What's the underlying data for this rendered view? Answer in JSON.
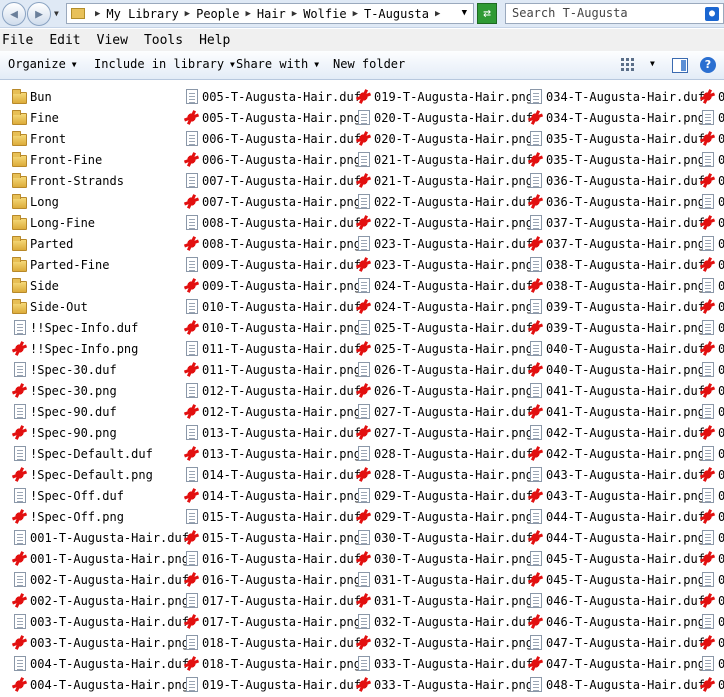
{
  "address": {
    "breadcrumbs": [
      "My Library",
      "People",
      "Hair",
      "Wolfie",
      "T-Augusta"
    ],
    "search_placeholder": "Search T-Augusta"
  },
  "menu": [
    "File",
    "Edit",
    "View",
    "Tools",
    "Help"
  ],
  "command_bar": {
    "organize": "Organize",
    "include": "Include in library",
    "share": "Share with",
    "new_folder": "New folder"
  },
  "files": {
    "columns": [
      [
        {
          "name": "Bun",
          "type": "folder"
        },
        {
          "name": "Fine",
          "type": "folder"
        },
        {
          "name": "Front",
          "type": "folder"
        },
        {
          "name": "Front-Fine",
          "type": "folder"
        },
        {
          "name": "Front-Strands",
          "type": "folder"
        },
        {
          "name": "Long",
          "type": "folder"
        },
        {
          "name": "Long-Fine",
          "type": "folder"
        },
        {
          "name": "Parted",
          "type": "folder"
        },
        {
          "name": "Parted-Fine",
          "type": "folder"
        },
        {
          "name": "Side",
          "type": "folder"
        },
        {
          "name": "Side-Out",
          "type": "folder"
        },
        {
          "name": "!!Spec-Info.duf",
          "type": "duf"
        },
        {
          "name": "!!Spec-Info.png",
          "type": "png"
        },
        {
          "name": "!Spec-30.duf",
          "type": "duf"
        },
        {
          "name": "!Spec-30.png",
          "type": "png"
        },
        {
          "name": "!Spec-90.duf",
          "type": "duf"
        },
        {
          "name": "!Spec-90.png",
          "type": "png"
        },
        {
          "name": "!Spec-Default.duf",
          "type": "duf"
        },
        {
          "name": "!Spec-Default.png",
          "type": "png"
        },
        {
          "name": "!Spec-Off.duf",
          "type": "duf"
        },
        {
          "name": "!Spec-Off.png",
          "type": "png"
        },
        {
          "name": "001-T-Augusta-Hair.duf",
          "type": "duf"
        },
        {
          "name": "001-T-Augusta-Hair.png",
          "type": "png"
        },
        {
          "name": "002-T-Augusta-Hair.duf",
          "type": "duf"
        },
        {
          "name": "002-T-Augusta-Hair.png",
          "type": "png"
        },
        {
          "name": "003-T-Augusta-Hair.duf",
          "type": "duf"
        },
        {
          "name": "003-T-Augusta-Hair.png",
          "type": "png"
        },
        {
          "name": "004-T-Augusta-Hair.duf",
          "type": "duf"
        },
        {
          "name": "004-T-Augusta-Hair.png",
          "type": "png"
        }
      ],
      [
        {
          "name": "005-T-Augusta-Hair.duf",
          "type": "duf"
        },
        {
          "name": "005-T-Augusta-Hair.png",
          "type": "png"
        },
        {
          "name": "006-T-Augusta-Hair.duf",
          "type": "duf"
        },
        {
          "name": "006-T-Augusta-Hair.png",
          "type": "png"
        },
        {
          "name": "007-T-Augusta-Hair.duf",
          "type": "duf"
        },
        {
          "name": "007-T-Augusta-Hair.png",
          "type": "png"
        },
        {
          "name": "008-T-Augusta-Hair.duf",
          "type": "duf"
        },
        {
          "name": "008-T-Augusta-Hair.png",
          "type": "png"
        },
        {
          "name": "009-T-Augusta-Hair.duf",
          "type": "duf"
        },
        {
          "name": "009-T-Augusta-Hair.png",
          "type": "png"
        },
        {
          "name": "010-T-Augusta-Hair.duf",
          "type": "duf"
        },
        {
          "name": "010-T-Augusta-Hair.png",
          "type": "png"
        },
        {
          "name": "011-T-Augusta-Hair.duf",
          "type": "duf"
        },
        {
          "name": "011-T-Augusta-Hair.png",
          "type": "png"
        },
        {
          "name": "012-T-Augusta-Hair.duf",
          "type": "duf"
        },
        {
          "name": "012-T-Augusta-Hair.png",
          "type": "png"
        },
        {
          "name": "013-T-Augusta-Hair.duf",
          "type": "duf"
        },
        {
          "name": "013-T-Augusta-Hair.png",
          "type": "png"
        },
        {
          "name": "014-T-Augusta-Hair.duf",
          "type": "duf"
        },
        {
          "name": "014-T-Augusta-Hair.png",
          "type": "png"
        },
        {
          "name": "015-T-Augusta-Hair.duf",
          "type": "duf"
        },
        {
          "name": "015-T-Augusta-Hair.png",
          "type": "png"
        },
        {
          "name": "016-T-Augusta-Hair.duf",
          "type": "duf"
        },
        {
          "name": "016-T-Augusta-Hair.png",
          "type": "png"
        },
        {
          "name": "017-T-Augusta-Hair.duf",
          "type": "duf"
        },
        {
          "name": "017-T-Augusta-Hair.png",
          "type": "png"
        },
        {
          "name": "018-T-Augusta-Hair.duf",
          "type": "duf"
        },
        {
          "name": "018-T-Augusta-Hair.png",
          "type": "png"
        },
        {
          "name": "019-T-Augusta-Hair.duf",
          "type": "duf"
        }
      ],
      [
        {
          "name": "019-T-Augusta-Hair.png",
          "type": "png"
        },
        {
          "name": "020-T-Augusta-Hair.duf",
          "type": "duf"
        },
        {
          "name": "020-T-Augusta-Hair.png",
          "type": "png"
        },
        {
          "name": "021-T-Augusta-Hair.duf",
          "type": "duf"
        },
        {
          "name": "021-T-Augusta-Hair.png",
          "type": "png"
        },
        {
          "name": "022-T-Augusta-Hair.duf",
          "type": "duf"
        },
        {
          "name": "022-T-Augusta-Hair.png",
          "type": "png"
        },
        {
          "name": "023-T-Augusta-Hair.duf",
          "type": "duf"
        },
        {
          "name": "023-T-Augusta-Hair.png",
          "type": "png"
        },
        {
          "name": "024-T-Augusta-Hair.duf",
          "type": "duf"
        },
        {
          "name": "024-T-Augusta-Hair.png",
          "type": "png"
        },
        {
          "name": "025-T-Augusta-Hair.duf",
          "type": "duf"
        },
        {
          "name": "025-T-Augusta-Hair.png",
          "type": "png"
        },
        {
          "name": "026-T-Augusta-Hair.duf",
          "type": "duf"
        },
        {
          "name": "026-T-Augusta-Hair.png",
          "type": "png"
        },
        {
          "name": "027-T-Augusta-Hair.duf",
          "type": "duf"
        },
        {
          "name": "027-T-Augusta-Hair.png",
          "type": "png"
        },
        {
          "name": "028-T-Augusta-Hair.duf",
          "type": "duf"
        },
        {
          "name": "028-T-Augusta-Hair.png",
          "type": "png"
        },
        {
          "name": "029-T-Augusta-Hair.duf",
          "type": "duf"
        },
        {
          "name": "029-T-Augusta-Hair.png",
          "type": "png"
        },
        {
          "name": "030-T-Augusta-Hair.duf",
          "type": "duf"
        },
        {
          "name": "030-T-Augusta-Hair.png",
          "type": "png"
        },
        {
          "name": "031-T-Augusta-Hair.duf",
          "type": "duf"
        },
        {
          "name": "031-T-Augusta-Hair.png",
          "type": "png"
        },
        {
          "name": "032-T-Augusta-Hair.duf",
          "type": "duf"
        },
        {
          "name": "032-T-Augusta-Hair.png",
          "type": "png"
        },
        {
          "name": "033-T-Augusta-Hair.duf",
          "type": "duf"
        },
        {
          "name": "033-T-Augusta-Hair.png",
          "type": "png"
        }
      ],
      [
        {
          "name": "034-T-Augusta-Hair.duf",
          "type": "duf"
        },
        {
          "name": "034-T-Augusta-Hair.png",
          "type": "png"
        },
        {
          "name": "035-T-Augusta-Hair.duf",
          "type": "duf"
        },
        {
          "name": "035-T-Augusta-Hair.png",
          "type": "png"
        },
        {
          "name": "036-T-Augusta-Hair.duf",
          "type": "duf"
        },
        {
          "name": "036-T-Augusta-Hair.png",
          "type": "png"
        },
        {
          "name": "037-T-Augusta-Hair.duf",
          "type": "duf"
        },
        {
          "name": "037-T-Augusta-Hair.png",
          "type": "png"
        },
        {
          "name": "038-T-Augusta-Hair.duf",
          "type": "duf"
        },
        {
          "name": "038-T-Augusta-Hair.png",
          "type": "png"
        },
        {
          "name": "039-T-Augusta-Hair.duf",
          "type": "duf"
        },
        {
          "name": "039-T-Augusta-Hair.png",
          "type": "png"
        },
        {
          "name": "040-T-Augusta-Hair.duf",
          "type": "duf"
        },
        {
          "name": "040-T-Augusta-Hair.png",
          "type": "png"
        },
        {
          "name": "041-T-Augusta-Hair.duf",
          "type": "duf"
        },
        {
          "name": "041-T-Augusta-Hair.png",
          "type": "png"
        },
        {
          "name": "042-T-Augusta-Hair.duf",
          "type": "duf"
        },
        {
          "name": "042-T-Augusta-Hair.png",
          "type": "png"
        },
        {
          "name": "043-T-Augusta-Hair.duf",
          "type": "duf"
        },
        {
          "name": "043-T-Augusta-Hair.png",
          "type": "png"
        },
        {
          "name": "044-T-Augusta-Hair.duf",
          "type": "duf"
        },
        {
          "name": "044-T-Augusta-Hair.png",
          "type": "png"
        },
        {
          "name": "045-T-Augusta-Hair.duf",
          "type": "duf"
        },
        {
          "name": "045-T-Augusta-Hair.png",
          "type": "png"
        },
        {
          "name": "046-T-Augusta-Hair.duf",
          "type": "duf"
        },
        {
          "name": "046-T-Augusta-Hair.png",
          "type": "png"
        },
        {
          "name": "047-T-Augusta-Hair.duf",
          "type": "duf"
        },
        {
          "name": "047-T-Augusta-Hair.png",
          "type": "png"
        },
        {
          "name": "048-T-Augusta-Hair.duf",
          "type": "duf"
        }
      ],
      [
        {
          "name": "0",
          "type": "png"
        },
        {
          "name": "0",
          "type": "duf"
        },
        {
          "name": "0",
          "type": "png"
        },
        {
          "name": "0",
          "type": "duf"
        },
        {
          "name": "0",
          "type": "png"
        },
        {
          "name": "0",
          "type": "duf"
        },
        {
          "name": "0",
          "type": "png"
        },
        {
          "name": "0",
          "type": "duf"
        },
        {
          "name": "0",
          "type": "png"
        },
        {
          "name": "0",
          "type": "duf"
        },
        {
          "name": "0",
          "type": "png"
        },
        {
          "name": "0",
          "type": "duf"
        },
        {
          "name": "0",
          "type": "png"
        },
        {
          "name": "0",
          "type": "duf"
        },
        {
          "name": "0",
          "type": "png"
        },
        {
          "name": "0",
          "type": "duf"
        },
        {
          "name": "0",
          "type": "png"
        },
        {
          "name": "0",
          "type": "duf"
        },
        {
          "name": "0",
          "type": "png"
        },
        {
          "name": "0",
          "type": "duf"
        },
        {
          "name": "0",
          "type": "png"
        },
        {
          "name": "0",
          "type": "duf"
        },
        {
          "name": "0",
          "type": "png"
        },
        {
          "name": "0",
          "type": "duf"
        },
        {
          "name": "0",
          "type": "png"
        },
        {
          "name": "0",
          "type": "duf"
        },
        {
          "name": "0",
          "type": "png"
        },
        {
          "name": "0",
          "type": "duf"
        },
        {
          "name": "0",
          "type": "png"
        }
      ]
    ]
  }
}
